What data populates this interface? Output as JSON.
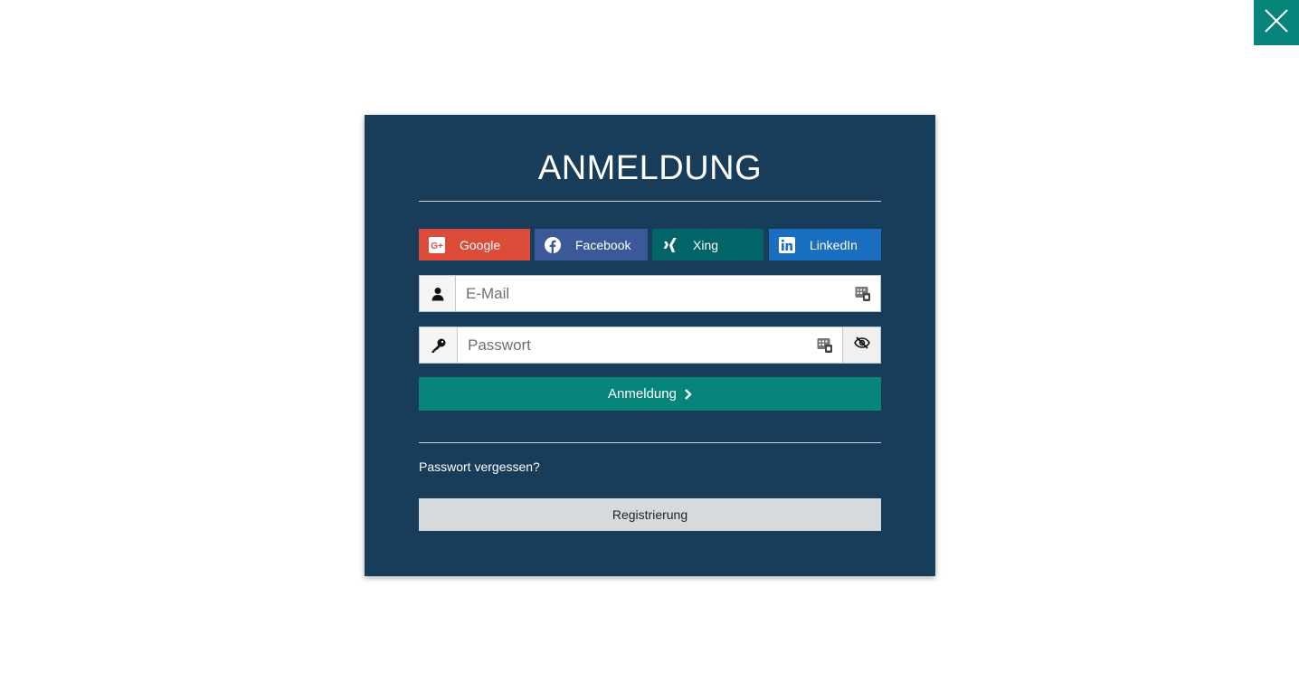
{
  "close": {
    "icon": "close-icon"
  },
  "modal": {
    "title": "ANMELDUNG",
    "social": [
      {
        "label": "Google",
        "icon": "google-plus-icon",
        "color": "#dd4b39"
      },
      {
        "label": "Facebook",
        "icon": "facebook-icon",
        "color": "#3b5998"
      },
      {
        "label": "Xing",
        "icon": "xing-icon",
        "color": "#026466"
      },
      {
        "label": "LinkedIn",
        "icon": "linkedin-icon",
        "color": "#1a6ec0"
      }
    ],
    "email": {
      "placeholder": "E-Mail",
      "value": "",
      "icon": "user-icon"
    },
    "password": {
      "placeholder": "Passwort",
      "value": "",
      "icon": "key-icon",
      "toggle_icon": "eye-slash-icon"
    },
    "submit_label": "Anmeldung",
    "forgot_label": "Passwort vergessen?",
    "register_label": "Registrierung"
  },
  "colors": {
    "panel": "#183d5a",
    "accent": "#07857a",
    "register_bg": "#d7dadc"
  }
}
